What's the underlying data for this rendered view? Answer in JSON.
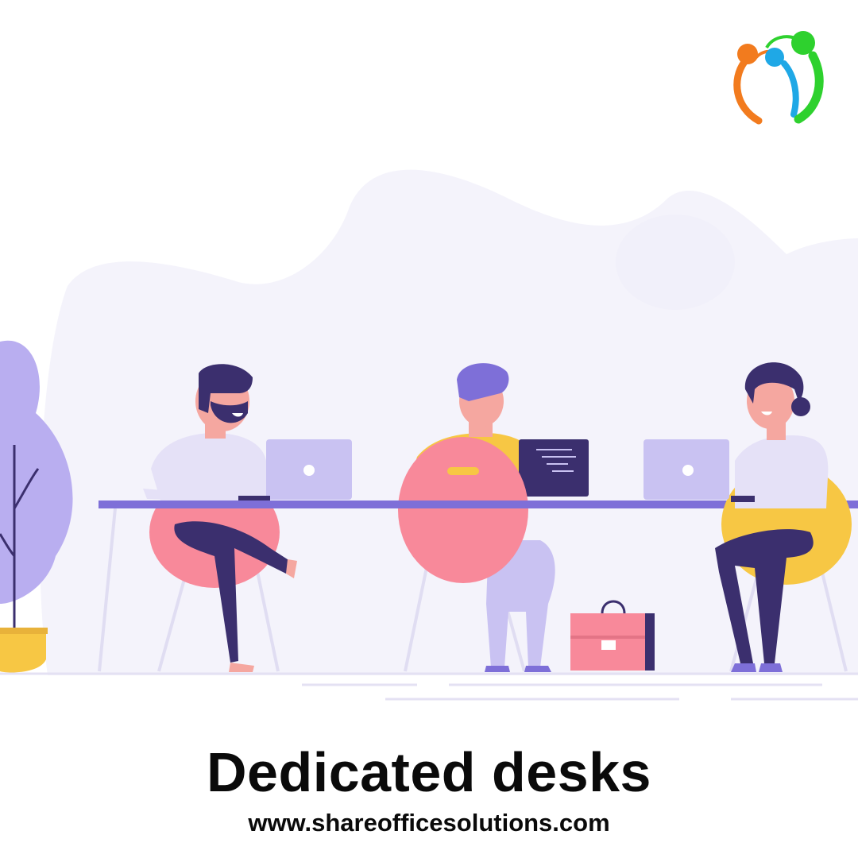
{
  "poster": {
    "headline": "Dedicated desks",
    "website": "www.shareofficesolutions.com"
  },
  "logo": {
    "icon": "people-circle-logo-icon",
    "colors": {
      "orange": "#F27B1E",
      "blue": "#1FA8E6",
      "green": "#2ED12E"
    }
  },
  "illustration": {
    "scene": "coworking-desk-illustration",
    "colors": {
      "background_blob": "#F4F3FB",
      "desk": "#7E6FD8",
      "laptop": "#C9C2F2",
      "chair_pink": "#F8899A",
      "chair_yellow": "#F7C744",
      "skin": "#F5A7A0",
      "dark_navy": "#3B2F6E",
      "plant": "#B9AEF0"
    }
  }
}
